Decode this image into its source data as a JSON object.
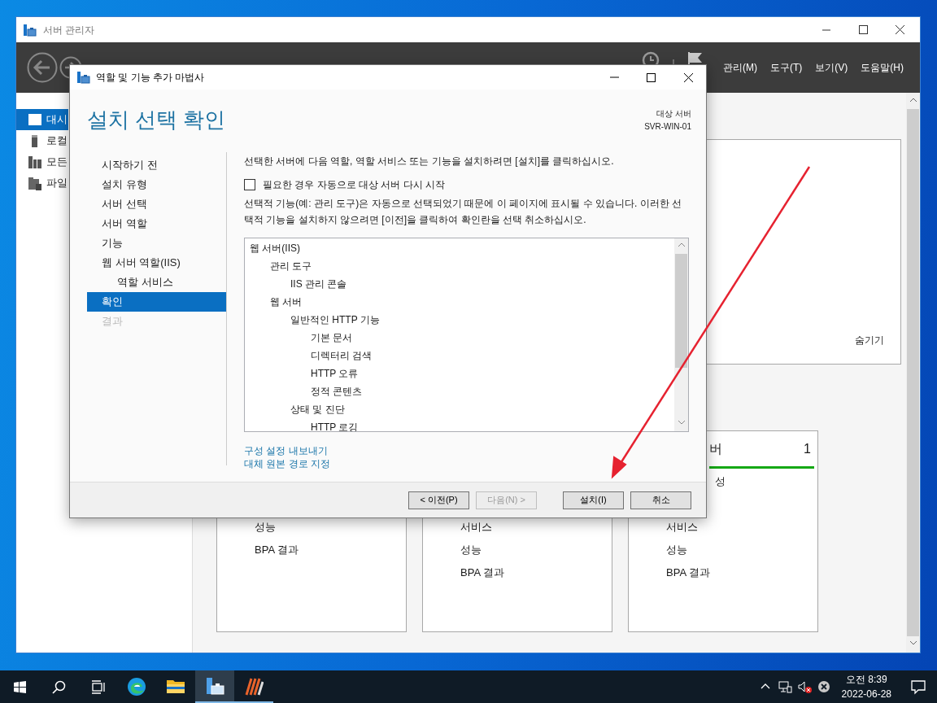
{
  "server_manager": {
    "title": "서버 관리자",
    "menu": [
      "관리(M)",
      "도구(T)",
      "보기(V)",
      "도움말(H)"
    ],
    "sidebar": [
      {
        "label": "대시",
        "selected": true
      },
      {
        "label": "로컬",
        "selected": false
      },
      {
        "label": "모든",
        "selected": false
      },
      {
        "label": "파일",
        "selected": false
      }
    ],
    "welcome_panel": {
      "hide_link": "숨기기"
    },
    "tiles": [
      {
        "items": [
          "성능",
          "BPA 결과"
        ]
      },
      {
        "items": [
          "서비스",
          "성능",
          "BPA 결과"
        ]
      },
      {
        "title": "버",
        "count": "1",
        "items": [
          "성",
          "서비스",
          "성능",
          "BPA 결과"
        ]
      }
    ]
  },
  "wizard": {
    "title": "역할 및 기능 추가 마법사",
    "heading": "설치 선택 확인",
    "target_label": "대상 서버",
    "target_server": "SVR-WIN-01",
    "steps": [
      {
        "label": "시작하기 전",
        "selected": false,
        "disabled": false
      },
      {
        "label": "설치 유형",
        "selected": false,
        "disabled": false
      },
      {
        "label": "서버 선택",
        "selected": false,
        "disabled": false
      },
      {
        "label": "서버 역할",
        "selected": false,
        "disabled": false
      },
      {
        "label": "기능",
        "selected": false,
        "disabled": false
      },
      {
        "label": "웹 서버 역할(IIS)",
        "selected": false,
        "disabled": false,
        "children": [
          {
            "label": "역할 서비스",
            "selected": false,
            "disabled": false
          }
        ]
      },
      {
        "label": "확인",
        "selected": true,
        "disabled": false
      },
      {
        "label": "결과",
        "selected": false,
        "disabled": true
      }
    ],
    "intro": "선택한 서버에 다음 역할, 역할 서비스 또는 기능을 설치하려면 [설치]를 클릭하십시오.",
    "restart_option": {
      "label": "필요한 경우 자동으로 대상 서버 다시 시작",
      "checked": false
    },
    "note": "선택적 기능(예: 관리 도구)은 자동으로 선택되었기 때문에 이 페이지에 표시될 수 있습니다. 이러한 선택적 기능을 설치하지 않으려면 [이전]을 클릭하여 확인란을 선택 취소하십시오.",
    "features": [
      {
        "label": "웹 서버(IIS)",
        "children": [
          {
            "label": "관리 도구",
            "children": [
              {
                "label": "IIS 관리 콘솔"
              }
            ]
          },
          {
            "label": "웹 서버",
            "children": [
              {
                "label": "일반적인 HTTP 기능",
                "children": [
                  {
                    "label": "기본 문서"
                  },
                  {
                    "label": "디렉터리 검색"
                  },
                  {
                    "label": "HTTP 오류"
                  },
                  {
                    "label": "정적 콘텐츠"
                  }
                ]
              },
              {
                "label": "상태 및 진단",
                "children": [
                  {
                    "label": "HTTP 로깅"
                  }
                ]
              }
            ]
          }
        ]
      }
    ],
    "links": [
      "구성 설정 내보내기",
      "대체 원본 경로 지정"
    ],
    "buttons": [
      {
        "label": "< 이전(P)",
        "disabled": false
      },
      {
        "label": "다음(N) >",
        "disabled": true
      },
      {
        "label": "설치(I)",
        "disabled": false
      },
      {
        "label": "취소",
        "disabled": false
      }
    ]
  },
  "taskbar": {
    "apps": [
      {
        "kind": "browser",
        "active": false,
        "running": false
      },
      {
        "kind": "folder",
        "active": false,
        "running": false
      },
      {
        "kind": "server",
        "active": true,
        "running": true
      },
      {
        "kind": "app",
        "active": false,
        "running": true
      }
    ],
    "time": "오전 8:39",
    "date": "2022-06-28"
  }
}
